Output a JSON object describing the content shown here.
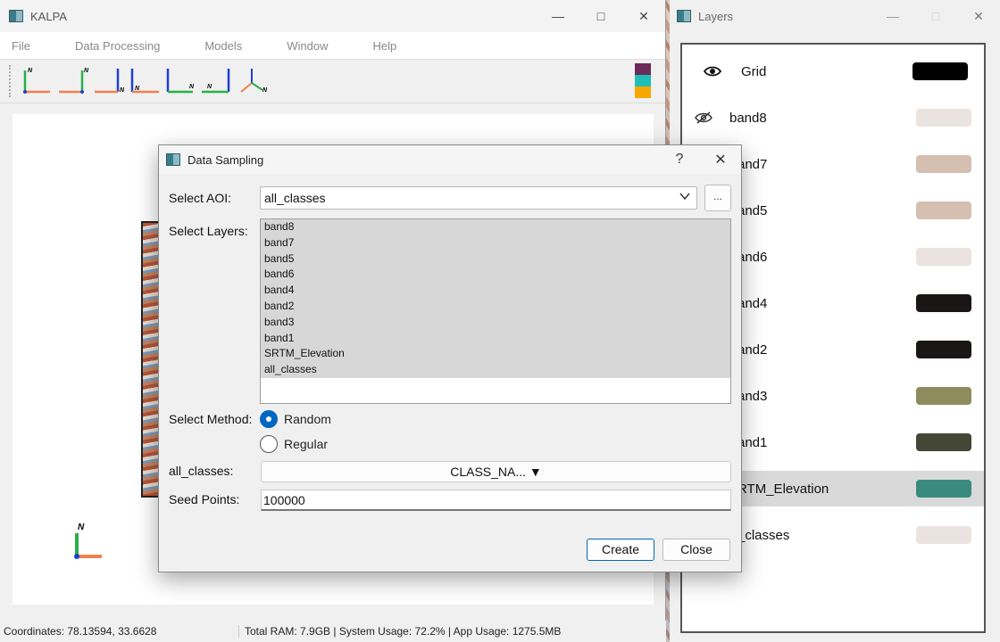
{
  "main_window": {
    "title": "KALPA",
    "menu": [
      "File",
      "Data Processing",
      "Models",
      "Window",
      "Help"
    ],
    "toolbar": {
      "axis_buttons": [
        "axis-view-1-icon",
        "axis-view-2-icon",
        "axis-view-3-icon",
        "axis-view-4-icon",
        "axis-view-5-icon",
        "axis-view-6-icon",
        "axis-view-3d-icon"
      ],
      "colors": [
        "#6b2a5a",
        "#1fbfb5",
        "#f7a800"
      ]
    },
    "corner_axis_label": "N",
    "status": {
      "coordinates": "Coordinates: 78.13594, 33.6628",
      "usage": "Total RAM: 7.9GB | System Usage: 72.2% | App Usage: 1275.5MB"
    }
  },
  "layers_window": {
    "title": "Layers",
    "layers": [
      {
        "label": "Grid",
        "visible": true,
        "color": "#000000"
      },
      {
        "label": "band8",
        "visible": false,
        "color": "#ebe3df"
      },
      {
        "label": "and7",
        "visible": null,
        "color": "#d4bfb1"
      },
      {
        "label": "and5",
        "visible": null,
        "color": "#d4bfb1"
      },
      {
        "label": "and6",
        "visible": null,
        "color": "#ebe3df"
      },
      {
        "label": "and4",
        "visible": null,
        "color": "#1a1615"
      },
      {
        "label": "and2",
        "visible": null,
        "color": "#1a1615"
      },
      {
        "label": "and3",
        "visible": null,
        "color": "#8e8c5c"
      },
      {
        "label": "and1",
        "visible": null,
        "color": "#444636"
      },
      {
        "label": "RTM_Elevation",
        "visible": null,
        "color": "#3b8a7f",
        "selected": true
      },
      {
        "label": "_classes",
        "visible": null,
        "color": "#ebe3df"
      }
    ]
  },
  "dialog": {
    "title": "Data Sampling",
    "help": "?",
    "close": "✕",
    "aoi_label": "Select AOI:",
    "aoi_value": "all_classes",
    "browse_label": "...",
    "layers_label": "Select Layers:",
    "layers": [
      "band8",
      "band7",
      "band5",
      "band6",
      "band4",
      "band2",
      "band3",
      "band1",
      "SRTM_Elevation",
      "all_classes"
    ],
    "method_label": "Select Method:",
    "methods": [
      {
        "label": "Random",
        "checked": true
      },
      {
        "label": "Regular",
        "checked": false
      }
    ],
    "class_label": "all_classes:",
    "class_value": "CLASS_NA... ▼",
    "seed_label": "Seed Points:",
    "seed_value": "100000",
    "create_label": "Create",
    "close_label": "Close"
  }
}
